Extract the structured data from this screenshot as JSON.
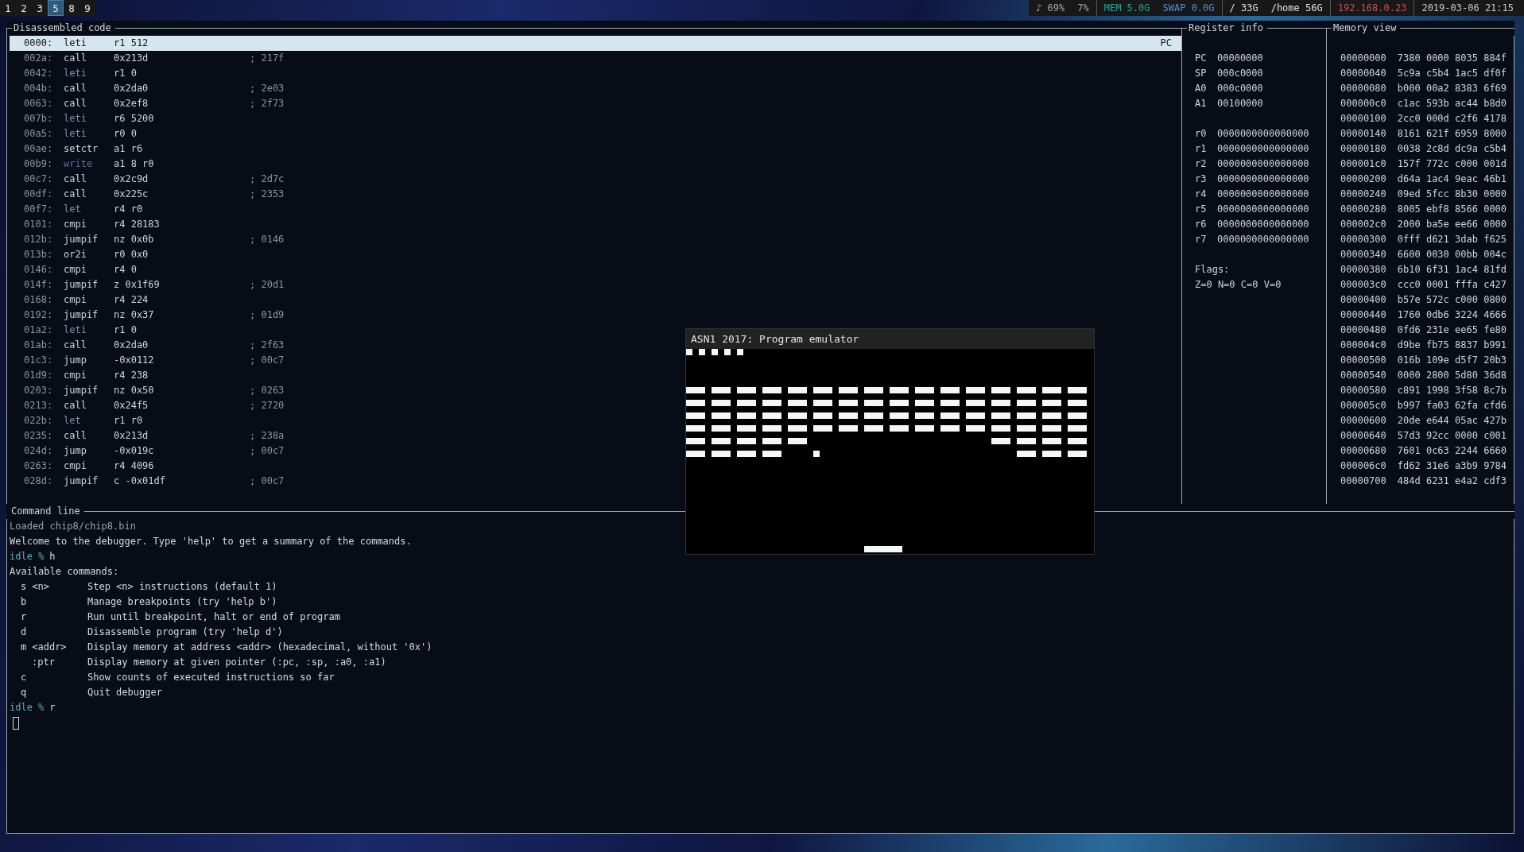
{
  "top_bar": {
    "workspaces": [
      {
        "label": "1",
        "selected": false
      },
      {
        "label": "2",
        "selected": false
      },
      {
        "label": "3",
        "selected": false
      },
      {
        "label": "5",
        "selected": true
      },
      {
        "label": "8",
        "selected": false
      },
      {
        "label": "9",
        "selected": false
      }
    ],
    "status_groups": [
      [
        {
          "text": "♪ 69%",
          "color": "#a8a8a8"
        },
        {
          "text": "7%",
          "color": "#a8a8a8"
        }
      ],
      [
        {
          "text": "MEM 5.0G",
          "color": "#2aa198"
        },
        {
          "text": "SWAP 0.0G",
          "color": "#4f8fd0"
        }
      ],
      [
        {
          "text": "/ 33G",
          "color": "#e0e0e0"
        },
        {
          "text": "/home 56G",
          "color": "#e0e0e0"
        }
      ],
      [
        {
          "text": "192.168.0.23",
          "color": "#c05555"
        }
      ],
      [
        {
          "text": "2019-03-06 21:15",
          "color": "#c8c8c8"
        }
      ]
    ]
  },
  "disassembly": {
    "title": "Disassembled code",
    "rows": [
      {
        "address": "0000:",
        "op": "leti",
        "args": "r1 512",
        "comment": "",
        "selected": true,
        "marker": "PC"
      },
      {
        "address": "002a:",
        "op": "call",
        "args": "0x213d",
        "comment": "; 217f",
        "color": "#d0d4d8",
        "selected": false
      },
      {
        "address": "0042:",
        "op": "leti",
        "args": "r1 0",
        "comment": "",
        "color": "#7f8ea3",
        "selected": false
      },
      {
        "address": "004b:",
        "op": "call",
        "args": "0x2da0",
        "comment": "; 2e03",
        "color": "#d0d4d8",
        "selected": false
      },
      {
        "address": "0063:",
        "op": "call",
        "args": "0x2ef8",
        "comment": "; 2f73",
        "color": "#d0d4d8",
        "selected": false
      },
      {
        "address": "007b:",
        "op": "leti",
        "args": "r6 5200",
        "comment": "",
        "color": "#7f8ea3",
        "selected": false
      },
      {
        "address": "00a5:",
        "op": "leti",
        "args": "r0 0",
        "comment": "",
        "color": "#7f8ea3",
        "selected": false
      },
      {
        "address": "00ae:",
        "op": "setctr",
        "args": "a1 r6",
        "comment": "",
        "color": "#d0d4d8",
        "selected": false
      },
      {
        "address": "00b9:",
        "op": "write",
        "args": "a1 8 r0",
        "comment": "",
        "color": "#5d6f9e",
        "selected": false
      },
      {
        "address": "00c7:",
        "op": "call",
        "args": "0x2c9d",
        "comment": "; 2d7c",
        "color": "#d0d4d8",
        "selected": false
      },
      {
        "address": "00df:",
        "op": "call",
        "args": "0x225c",
        "comment": "; 2353",
        "color": "#d0d4d8",
        "selected": false
      },
      {
        "address": "00f7:",
        "op": "let",
        "args": "r4 r0",
        "comment": "",
        "color": "#7f8ea3",
        "selected": false
      },
      {
        "address": "0101:",
        "op": "cmpi",
        "args": "r4 28183",
        "comment": "",
        "color": "#d0d4d8",
        "selected": false
      },
      {
        "address": "012b:",
        "op": "jumpif",
        "args": "nz 0x0b",
        "comment": "; 0146",
        "color": "#d0d4d8",
        "selected": false
      },
      {
        "address": "013b:",
        "op": "or2i",
        "args": "r0 0x0",
        "comment": "",
        "color": "#d0d4d8",
        "selected": false
      },
      {
        "address": "0146:",
        "op": "cmpi",
        "args": "r4 0",
        "comment": "",
        "color": "#d0d4d8",
        "selected": false
      },
      {
        "address": "014f:",
        "op": "jumpif",
        "args": "z 0x1f69",
        "comment": "; 20d1",
        "color": "#d0d4d8",
        "selected": false
      },
      {
        "address": "0168:",
        "op": "cmpi",
        "args": "r4 224",
        "comment": "",
        "color": "#d0d4d8",
        "selected": false
      },
      {
        "address": "0192:",
        "op": "jumpif",
        "args": "nz 0x37",
        "comment": "; 01d9",
        "color": "#d0d4d8",
        "selected": false
      },
      {
        "address": "01a2:",
        "op": "leti",
        "args": "r1 0",
        "comment": "",
        "color": "#7f8ea3",
        "selected": false
      },
      {
        "address": "01ab:",
        "op": "call",
        "args": "0x2da0",
        "comment": "; 2f63",
        "color": "#d0d4d8",
        "selected": false
      },
      {
        "address": "01c3:",
        "op": "jump",
        "args": "-0x0112",
        "comment": "; 00c7",
        "color": "#d0d4d8",
        "selected": false
      },
      {
        "address": "01d9:",
        "op": "cmpi",
        "args": "r4 238",
        "comment": "",
        "color": "#d0d4d8",
        "selected": false
      },
      {
        "address": "0203:",
        "op": "jumpif",
        "args": "nz 0x50",
        "comment": "; 0263",
        "color": "#d0d4d8",
        "selected": false
      },
      {
        "address": "0213:",
        "op": "call",
        "args": "0x24f5",
        "comment": "; 2720",
        "color": "#d0d4d8",
        "selected": false
      },
      {
        "address": "022b:",
        "op": "let",
        "args": "r1 r0",
        "comment": "",
        "color": "#7f8ea3",
        "selected": false
      },
      {
        "address": "0235:",
        "op": "call",
        "args": "0x213d",
        "comment": "; 238a",
        "color": "#d0d4d8",
        "selected": false
      },
      {
        "address": "024d:",
        "op": "jump",
        "args": "-0x019c",
        "comment": "; 00c7",
        "color": "#d0d4d8",
        "selected": false
      },
      {
        "address": "0263:",
        "op": "cmpi",
        "args": "r4 4096",
        "comment": "",
        "color": "#d0d4d8",
        "selected": false
      },
      {
        "address": "028d:",
        "op": "jumpif",
        "args": "c -0x01df",
        "comment": "; 00c7",
        "color": "#d0d4d8",
        "selected": false
      }
    ]
  },
  "registers": {
    "title": "Register info",
    "pointers": [
      {
        "name": "PC",
        "value": "00000000"
      },
      {
        "name": "SP",
        "value": "000c0000"
      },
      {
        "name": "A0",
        "value": "000c0000"
      },
      {
        "name": "A1",
        "value": "00100000"
      }
    ],
    "general": [
      {
        "name": "r0",
        "value": "0000000000000000"
      },
      {
        "name": "r1",
        "value": "0000000000000000"
      },
      {
        "name": "r2",
        "value": "0000000000000000"
      },
      {
        "name": "r3",
        "value": "0000000000000000"
      },
      {
        "name": "r4",
        "value": "0000000000000000"
      },
      {
        "name": "r5",
        "value": "0000000000000000"
      },
      {
        "name": "r6",
        "value": "0000000000000000"
      },
      {
        "name": "r7",
        "value": "0000000000000000"
      }
    ],
    "flags_label": "Flags:",
    "flags": "Z=0 N=0 C=0 V=0"
  },
  "memory": {
    "title": "Memory view",
    "rows": [
      {
        "address": "00000000",
        "words": "7380 0000 8035 884f"
      },
      {
        "address": "00000040",
        "words": "5c9a c5b4 1ac5 df0f"
      },
      {
        "address": "00000080",
        "words": "b000 00a2 8383 6f69"
      },
      {
        "address": "000000c0",
        "words": "c1ac 593b ac44 b8d0"
      },
      {
        "address": "00000100",
        "words": "2cc0 000d c2f6 4178"
      },
      {
        "address": "00000140",
        "words": "8161 621f 6959 8000"
      },
      {
        "address": "00000180",
        "words": "0038 2c8d dc9a c5b4"
      },
      {
        "address": "000001c0",
        "words": "157f 772c c000 001d"
      },
      {
        "address": "00000200",
        "words": "d64a 1ac4 9eac 46b1"
      },
      {
        "address": "00000240",
        "words": "09ed 5fcc 8b30 0000"
      },
      {
        "address": "00000280",
        "words": "8005 ebf8 8566 0000"
      },
      {
        "address": "000002c0",
        "words": "2000 ba5e ee66 0000"
      },
      {
        "address": "00000300",
        "words": "0fff d621 3dab f625"
      },
      {
        "address": "00000340",
        "words": "6600 0030 00bb 004c"
      },
      {
        "address": "00000380",
        "words": "6b10 6f31 1ac4 81fd"
      },
      {
        "address": "000003c0",
        "words": "ccc0 0001 fffa c427"
      },
      {
        "address": "00000400",
        "words": "b57e 572c c000 0800"
      },
      {
        "address": "00000440",
        "words": "1760 0db6 3224 4666"
      },
      {
        "address": "00000480",
        "words": "0fd6 231e ee65 fe80"
      },
      {
        "address": "000004c0",
        "words": "d9be fb75 8837 b991"
      },
      {
        "address": "00000500",
        "words": "016b 109e d5f7 20b3"
      },
      {
        "address": "00000540",
        "words": "0000 2800 5d80 36d8"
      },
      {
        "address": "00000580",
        "words": "c891 1998 3f58 8c7b"
      },
      {
        "address": "000005c0",
        "words": "b997 fa03 62fa cfd6"
      },
      {
        "address": "00000600",
        "words": "20de e644 05ac 427b"
      },
      {
        "address": "00000640",
        "words": "57d3 92cc 0000 c001"
      },
      {
        "address": "00000680",
        "words": "7601 0c63 2244 6660"
      },
      {
        "address": "000006c0",
        "words": "fd62 31e6 a3b9 9784"
      },
      {
        "address": "00000700",
        "words": "484d 6231 e4a2 cdf3"
      }
    ]
  },
  "command_line": {
    "title": "Command line",
    "lines": [
      {
        "kind": "info",
        "text": "Loaded chip8/chip8.bin"
      },
      {
        "kind": "output",
        "text": "Welcome to the debugger. Type 'help' to get a summary of the commands."
      },
      {
        "kind": "prompt",
        "prompt": "idle %",
        "input": "h"
      },
      {
        "kind": "output",
        "text": "Available commands:"
      },
      {
        "kind": "help",
        "command": "s",
        "argument": "<n>",
        "description": "Step <n> instructions (default 1)"
      },
      {
        "kind": "help",
        "command": "b",
        "description": "Manage breakpoints (try 'help b')"
      },
      {
        "kind": "help",
        "command": "r",
        "description": "Run until breakpoint, halt or end of program"
      },
      {
        "kind": "help",
        "command": "d",
        "description": "Disassemble program (try 'help d')"
      },
      {
        "kind": "help",
        "command": "m",
        "argument": "<addr>",
        "description": "Display memory at address <addr> (hexadecimal, without '0x')"
      },
      {
        "kind": "help",
        "argument": ":ptr",
        "description": "Display memory at given pointer (:pc, :sp, :a0, :a1)"
      },
      {
        "kind": "help",
        "command": "c",
        "description": "Show counts of executed instructions so far"
      },
      {
        "kind": "help",
        "command": "q",
        "description": "Quit debugger"
      },
      {
        "kind": "prompt",
        "prompt": "idle %",
        "input": "r"
      }
    ]
  },
  "emulator": {
    "title": "ASN1 2017: Program emulator"
  }
}
